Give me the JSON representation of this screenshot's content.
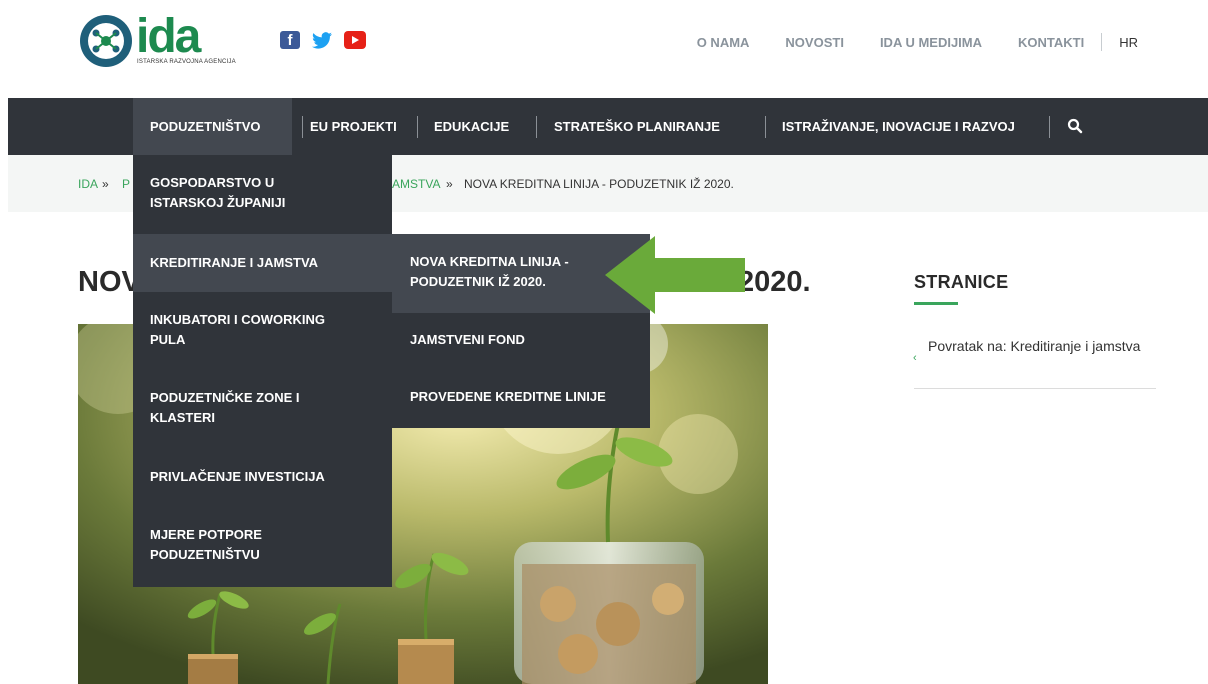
{
  "logo": {
    "wordmark": "ida",
    "subtitle": "ISTARSKA RAZVOJNA AGENCIJA"
  },
  "social": [
    "facebook-icon",
    "twitter-icon",
    "youtube-icon"
  ],
  "top_nav": {
    "items": [
      "O NAMA",
      "NOVOSTI",
      "IDA U MEDIJIMA",
      "KONTAKTI"
    ],
    "lang": "HR"
  },
  "main_nav": {
    "items": [
      "PODUZETNIŠTVO",
      "EU PROJEKTI",
      "EDUKACIJE",
      "STRATEŠKO PLANIRANJE",
      "ISTRAŽIVANJE, INOVACIJE I RAZVOJ"
    ],
    "active": "PODUZETNIŠTVO"
  },
  "breadcrumb": {
    "home": "IDA",
    "sep1": "»",
    "p": "P",
    "partial": "AMSTVA",
    "sep2": "»",
    "current": "NOVA KREDITNA LINIJA - PODUZETNIK IŽ 2020."
  },
  "page_title": {
    "left": "NOV",
    "right": "2020."
  },
  "dropdown": {
    "items": [
      [
        "GOSPODARSTVO U",
        "ISTARSKOJ ŽUPANIJI"
      ],
      [
        "KREDITIRANJE I JAMSTVA"
      ],
      [
        "INKUBATORI I COWORKING",
        "PULA"
      ],
      [
        "PODUZETNIČKE ZONE I",
        "KLASTERI"
      ],
      [
        "PRIVLAČENJE INVESTICIJA"
      ],
      [
        "MJERE POTPORE",
        "PODUZETNIŠTVU"
      ]
    ]
  },
  "subdropdown": {
    "items": [
      [
        "NOVA KREDITNA LINIJA -",
        "PODUZETNIK IŽ 2020."
      ],
      [
        "JAMSTVENI FOND"
      ],
      [
        "PROVEDENE KREDITNE LINIJE"
      ]
    ]
  },
  "sidebar": {
    "title": "STRANICE",
    "link": "Povratak na: Kreditiranje i jamstva"
  },
  "colors": {
    "nav_bg": "#30343a",
    "nav_active": "#434850",
    "accent_green": "#3aa55c",
    "arrow_green": "#6aaa3a"
  }
}
